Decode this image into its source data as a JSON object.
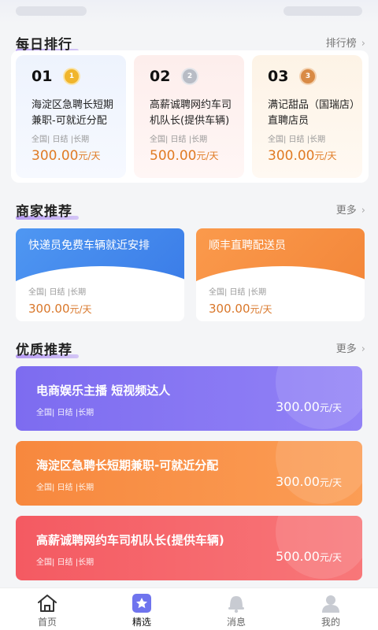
{
  "daily_ranking": {
    "title": "每日排行",
    "more_label": "排行榜",
    "items": [
      {
        "rank": "01",
        "medal": "gold",
        "title": "海淀区急聘长短期兼职-可就近分配",
        "tags": "全国| 日结 |长期",
        "amount": "300.00",
        "unit": "元/天"
      },
      {
        "rank": "02",
        "medal": "silver",
        "title": "高薪诚聘网约车司机队长(提供车辆)",
        "tags": "全国| 日结 |长期",
        "amount": "500.00",
        "unit": "元/天"
      },
      {
        "rank": "03",
        "medal": "bronze",
        "title": "满记甜品（国瑞店）直聘店员",
        "tags": "全国| 日结 |长期",
        "amount": "300.00",
        "unit": "元/天"
      }
    ]
  },
  "merchant": {
    "title": "商家推荐",
    "more_label": "更多",
    "items": [
      {
        "title": "快递员免费车辆就近安排",
        "tags": "全国| 日结 |长期",
        "amount": "300.00",
        "unit": "元/天",
        "color": "#4a8cf0"
      },
      {
        "title": "顺丰直聘配送员",
        "tags": "全国| 日结 |长期",
        "amount": "300.00",
        "unit": "元/天",
        "color": "#f7903f"
      }
    ]
  },
  "quality": {
    "title": "优质推荐",
    "more_label": "更多",
    "items": [
      {
        "title": "电商娱乐主播 短视频达人",
        "tags": "全国| 日结 |长期",
        "amount": "300.00",
        "unit": "元/天",
        "color": "#8574f2"
      },
      {
        "title": "海淀区急聘长短期兼职-可就近分配",
        "tags": "全国| 日结 |长期",
        "amount": "300.00",
        "unit": "元/天",
        "color": "#f8914a"
      },
      {
        "title": "高薪诚聘网约车司机队长(提供车辆)",
        "tags": "全国| 日结 |长期",
        "amount": "500.00",
        "unit": "元/天",
        "color": "#f5666c"
      }
    ]
  },
  "bottom_nav": {
    "items": [
      {
        "label": "首页",
        "icon": "home-icon"
      },
      {
        "label": "精选",
        "icon": "featured-star-icon",
        "active": true
      },
      {
        "label": "消息",
        "icon": "message-bell-icon"
      },
      {
        "label": "我的",
        "icon": "profile-icon"
      }
    ]
  }
}
